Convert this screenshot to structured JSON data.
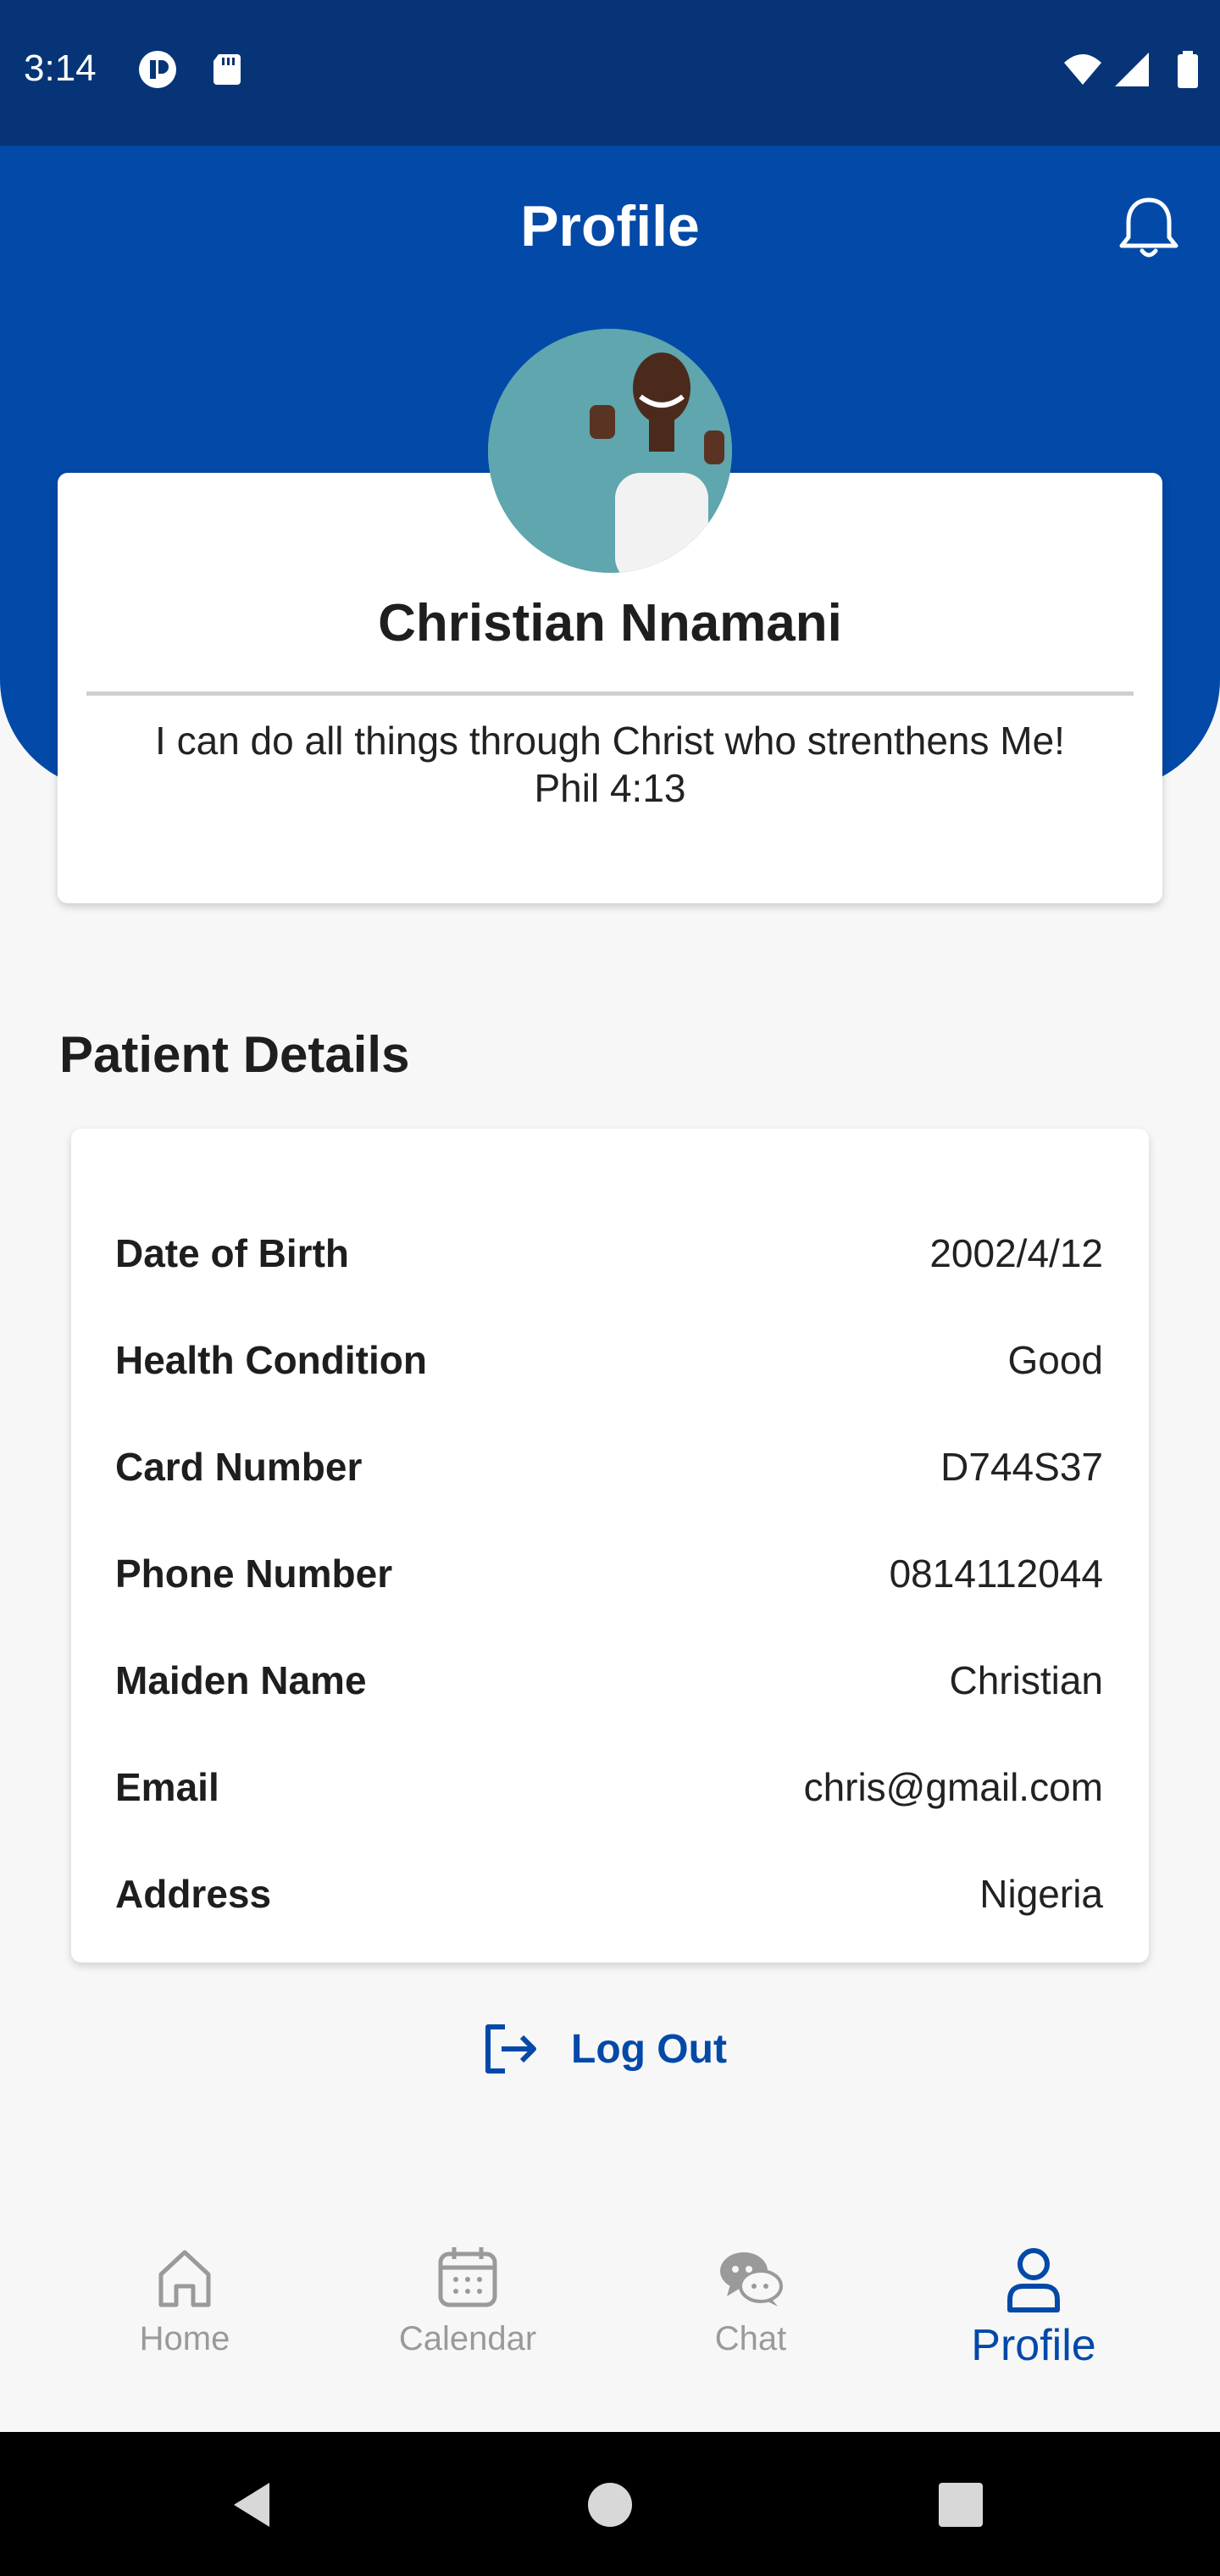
{
  "status_bar": {
    "time": "3:14"
  },
  "header": {
    "title": "Profile"
  },
  "profile": {
    "name": "Christian Nnamani",
    "quote_line1": "I can do all things through Christ who strenthens Me!",
    "quote_line2": "Phil 4:13"
  },
  "patient_details": {
    "title": "Patient Details",
    "rows": [
      {
        "label": "Date of Birth",
        "value": "2002/4/12"
      },
      {
        "label": "Health Condition",
        "value": "Good"
      },
      {
        "label": "Card Number",
        "value": "D744S37"
      },
      {
        "label": "Phone Number",
        "value": "0814112044"
      },
      {
        "label": "Maiden Name",
        "value": "Christian"
      },
      {
        "label": "Email",
        "value": "chris@gmail.com"
      },
      {
        "label": "Address",
        "value": "Nigeria"
      }
    ]
  },
  "logout": {
    "label": "Log Out"
  },
  "bottom_nav": {
    "items": [
      {
        "label": "Home",
        "icon": "home-icon"
      },
      {
        "label": "Calendar",
        "icon": "calendar-icon"
      },
      {
        "label": "Chat",
        "icon": "chat-icon"
      },
      {
        "label": "Profile",
        "icon": "person-icon",
        "active": true
      }
    ]
  },
  "colors": {
    "primary": "#0249a8",
    "status_bar": "#063477",
    "inactive": "#9a9a9a"
  }
}
